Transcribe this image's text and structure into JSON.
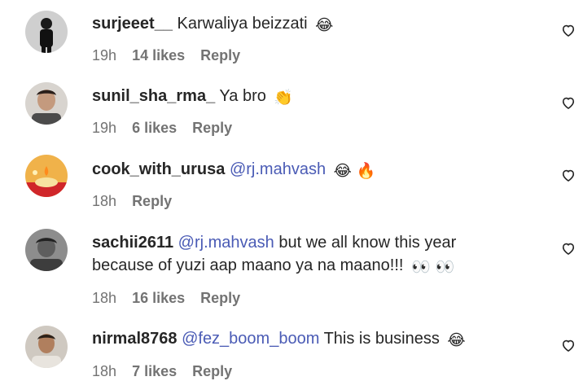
{
  "comments": [
    {
      "username": "surjeeet__",
      "mention": "",
      "text": "Karwaliya beizzati",
      "text2": "",
      "emojis": "😂",
      "time": "19h",
      "likes": "14 likes",
      "reply": "Reply",
      "avatar_color": "#3a3a3a"
    },
    {
      "username": "sunil_sha_rma_",
      "mention": "",
      "text": "Ya bro",
      "text2": "",
      "emojis": "👏",
      "time": "19h",
      "likes": "6 likes",
      "reply": "Reply",
      "avatar_color": "#5a4a44"
    },
    {
      "username": "cook_with_urusa",
      "mention": "@rj.mahvash",
      "text": "",
      "text2": "",
      "emojis": "😂 🔥",
      "time": "18h",
      "likes": "",
      "reply": "Reply",
      "avatar_color": "#e8a53a"
    },
    {
      "username": "sachii2611",
      "mention": "@rj.mahvash",
      "text": "but we all know this year",
      "text2": "because of yuzi aap maano ya na maano!!!",
      "emojis": "👀 👀",
      "time": "18h",
      "likes": "16 likes",
      "reply": "Reply",
      "avatar_color": "#6b6b6b"
    },
    {
      "username": "nirmal8768",
      "mention": "@fez_boom_boom",
      "text": "This is business",
      "text2": "",
      "emojis": "😂",
      "time": "18h",
      "likes": "7 likes",
      "reply": "Reply",
      "avatar_color": "#b9b0a6"
    }
  ],
  "colors": {
    "text": "#262626",
    "muted": "#737373",
    "mention": "#4a5bb5"
  },
  "icons": {
    "like": "heart-outline-icon"
  }
}
